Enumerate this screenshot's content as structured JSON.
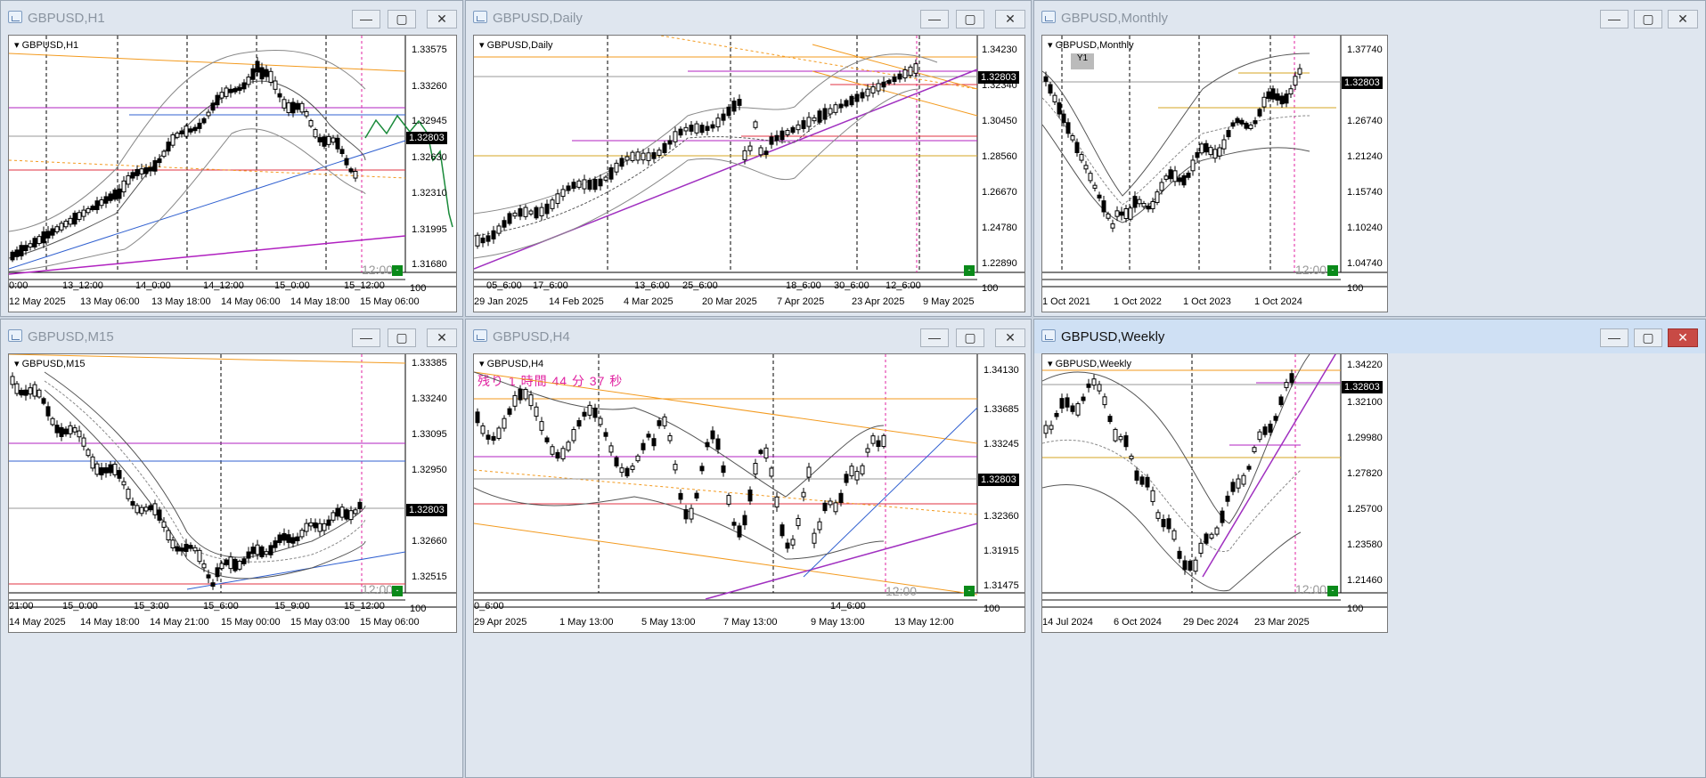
{
  "symbol_prefix": "GBPUSD",
  "current_price": "1.32803",
  "timer_text": "12:00",
  "countdown": "残り 1 時間 44 分 37 秒",
  "controls": {
    "minimize": "—",
    "maximize": "▢",
    "close": "✕"
  },
  "windows": [
    {
      "title": "GBPUSD,H1",
      "chart_label": "GBPUSD,H1",
      "prices": [
        "1.33575",
        "1.33260",
        "1.32945",
        "1.32630",
        "1.32310",
        "1.31995",
        "1.31680"
      ],
      "bottom_times": [
        "12 May 2025",
        "13 May 06:00",
        "13 May 18:00",
        "14 May 06:00",
        "14 May 18:00",
        "15 May 06:00"
      ],
      "sep_times": [
        "0:00",
        "13_12:00",
        "14_0:00",
        "14_12:00",
        "15_0:00",
        "15_12:00"
      ],
      "corner": "100"
    },
    {
      "title": "GBPUSD,Daily",
      "chart_label": "GBPUSD,Daily",
      "prices": [
        "1.34230",
        "1.32340",
        "1.30450",
        "1.28560",
        "1.26670",
        "1.24780",
        "1.22890"
      ],
      "bottom_times": [
        "29 Jan 2025",
        "14 Feb 2025",
        "4 Mar 2025",
        "20 Mar 2025",
        "7 Apr 2025",
        "23 Apr 2025",
        "9 May 2025"
      ],
      "sep_times": [
        "05_6:00",
        "17_6:00",
        "13_6:00",
        "25_6:00",
        "18_6:00",
        "30_6:00",
        "12_6:00"
      ],
      "corner": "100"
    },
    {
      "title": "GBPUSD,Monthly",
      "chart_label": "GBPUSD,Monthly",
      "prices": [
        "1.37740",
        "1.32660",
        "1.26740",
        "1.21240",
        "1.15740",
        "1.10240",
        "1.04740"
      ],
      "bottom_times": [
        "1 Oct 2021",
        "1 Oct 2022",
        "1 Oct 2023",
        "1 Oct 2024"
      ],
      "sep_times": [],
      "corner": "100",
      "badge": "Y1"
    },
    {
      "title": "GBPUSD,M15",
      "chart_label": "GBPUSD,M15",
      "prices": [
        "1.33385",
        "1.33240",
        "1.33095",
        "1.32950",
        "1.32660",
        "1.32515"
      ],
      "bottom_times": [
        "14 May 2025",
        "14 May 18:00",
        "14 May 21:00",
        "15 May 00:00",
        "15 May 03:00",
        "15 May 06:00"
      ],
      "sep_times": [
        "21:00",
        "15_0:00",
        "15_3:00",
        "15_6:00",
        "15_9:00",
        "15_12:00"
      ],
      "corner": "100"
    },
    {
      "title": "GBPUSD,H4",
      "chart_label": "GBPUSD,H4",
      "prices": [
        "1.34130",
        "1.33685",
        "1.33245",
        "1.32360",
        "1.31915",
        "1.31475"
      ],
      "bottom_times": [
        "29 Apr 2025",
        "1 May 13:00",
        "5 May 13:00",
        "7 May 13:00",
        "9 May 13:00",
        "13 May 12:00"
      ],
      "sep_times": [
        "0_6:00",
        "14_6:00"
      ],
      "corner": "100"
    },
    {
      "title": "GBPUSD,Weekly",
      "chart_label": "GBPUSD,Weekly",
      "prices": [
        "1.34220",
        "1.32100",
        "1.29980",
        "1.27820",
        "1.25700",
        "1.23580",
        "1.21460"
      ],
      "bottom_times": [
        "14 Jul 2024",
        "6 Oct 2024",
        "29 Dec 2024",
        "23 Mar 2025"
      ],
      "sep_times": [],
      "corner": "100"
    }
  ]
}
